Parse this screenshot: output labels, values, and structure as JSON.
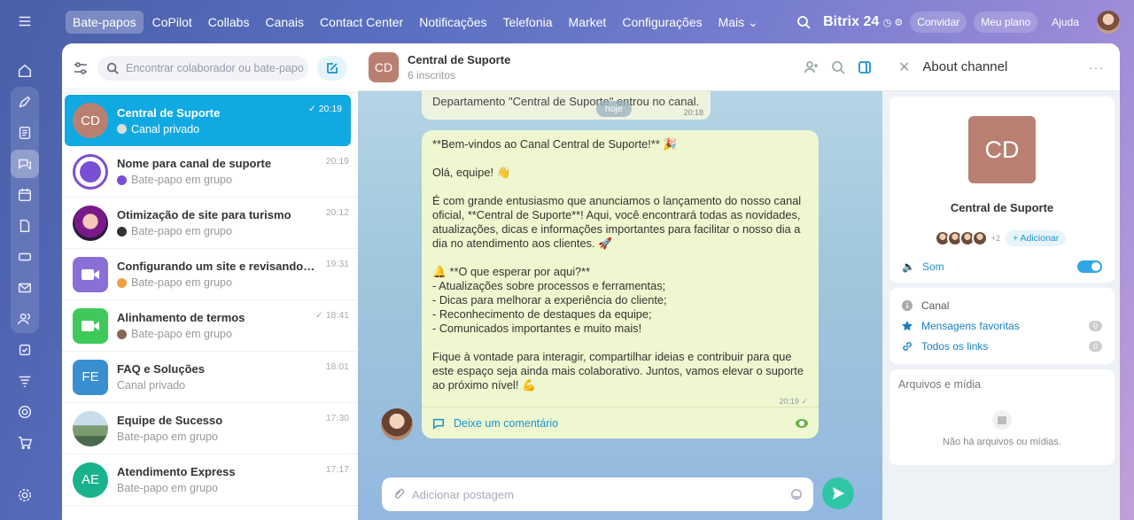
{
  "nav": {
    "items": [
      "Bate-papos",
      "CoPilot",
      "Collabs",
      "Canais",
      "Contact Center",
      "Notificações",
      "Telefonia",
      "Market",
      "Configurações",
      "Mais"
    ],
    "logo": "Bitrix 24",
    "invite": "Convidar",
    "plan": "Meu plano",
    "help": "Ajuda"
  },
  "list": {
    "search_placeholder": "Encontrar colaborador ou bate-papo",
    "items": [
      {
        "initials": "CD",
        "title": "Central de Suporte",
        "subtitle": "Canal privado",
        "time": "20:19",
        "color": "#b98071"
      },
      {
        "initials": "",
        "title": "Nome para canal de suporte",
        "subtitle": "Bate-papo em grupo",
        "time": "20:19",
        "color": "#7a4fd6"
      },
      {
        "initials": "",
        "title": "Otimização de site para turismo",
        "subtitle": "Bate-papo em grupo",
        "time": "20:12",
        "color": "#6b2a8a"
      },
      {
        "initials": "",
        "title": "Configurando um site e revisando os proj",
        "subtitle": "Bate-papo em grupo",
        "time": "19:31",
        "color": "#8a6fd6"
      },
      {
        "initials": "",
        "title": "Alinhamento de termos",
        "subtitle": "Bate-papo em grupo",
        "time": "18:41",
        "color": "#3ec95a"
      },
      {
        "initials": "FE",
        "title": "FAQ e Soluções",
        "subtitle": "Canal privado",
        "time": "18:01",
        "color": "#3a8fd0"
      },
      {
        "initials": "",
        "title": "Equipe de Sucesso",
        "subtitle": "Bate-papo em grupo",
        "time": "17:30",
        "color": "#7a9ab0"
      },
      {
        "initials": "AE",
        "title": "Atendimento Express",
        "subtitle": "Bate-papo em grupo",
        "time": "17:17",
        "color": "#19b28c"
      }
    ]
  },
  "chat": {
    "initials": "CD",
    "title": "Central de Suporte",
    "subtitle": "6 inscritos",
    "system_msg": "Departamento \"Central de Suporte\" entrou no canal.",
    "system_time": "20:18",
    "today": "hoje",
    "msg_p1": "**Bem-vindos ao Canal Central de Suporte!** 🎉",
    "msg_p2": "Olá, equipe! 👋",
    "msg_p3": "É com grande entusiasmo que anunciamos o lançamento do nosso canal oficial, **Central de Suporte**! Aqui, você encontrará todas as novidades, atualizações, dicas e informações importantes para facilitar o nosso dia a dia no atendimento aos clientes. 🚀",
    "msg_p4": "🔔 **O que esperar por aqui?**\n- Atualizações sobre processos e ferramentas;\n- Dicas para melhorar a experiência do cliente;\n- Reconhecimento de destaques da equipe;\n- Comunicados importantes e muito mais!",
    "msg_p5": "Fique à vontade para interagir, compartilhar ideias e contribuir para que este espaço seja ainda mais colaborativo. Juntos, vamos elevar o suporte ao próximo nível! 💪",
    "msg_time": "20:19",
    "comment": "Deixe um comentário",
    "input_placeholder": "Adicionar postagem"
  },
  "info": {
    "title": "About channel",
    "initials": "CD",
    "name": "Central de Suporte",
    "more_members": "+2",
    "add": "+ Adicionar",
    "sound": "Som",
    "channel": "Canal",
    "favorites": "Mensagens favoritas",
    "favorites_count": "0",
    "links": "Todos os links",
    "links_count": "0",
    "files": "Arquivos e mídia",
    "no_files": "Não há arquivos ou mídias."
  }
}
